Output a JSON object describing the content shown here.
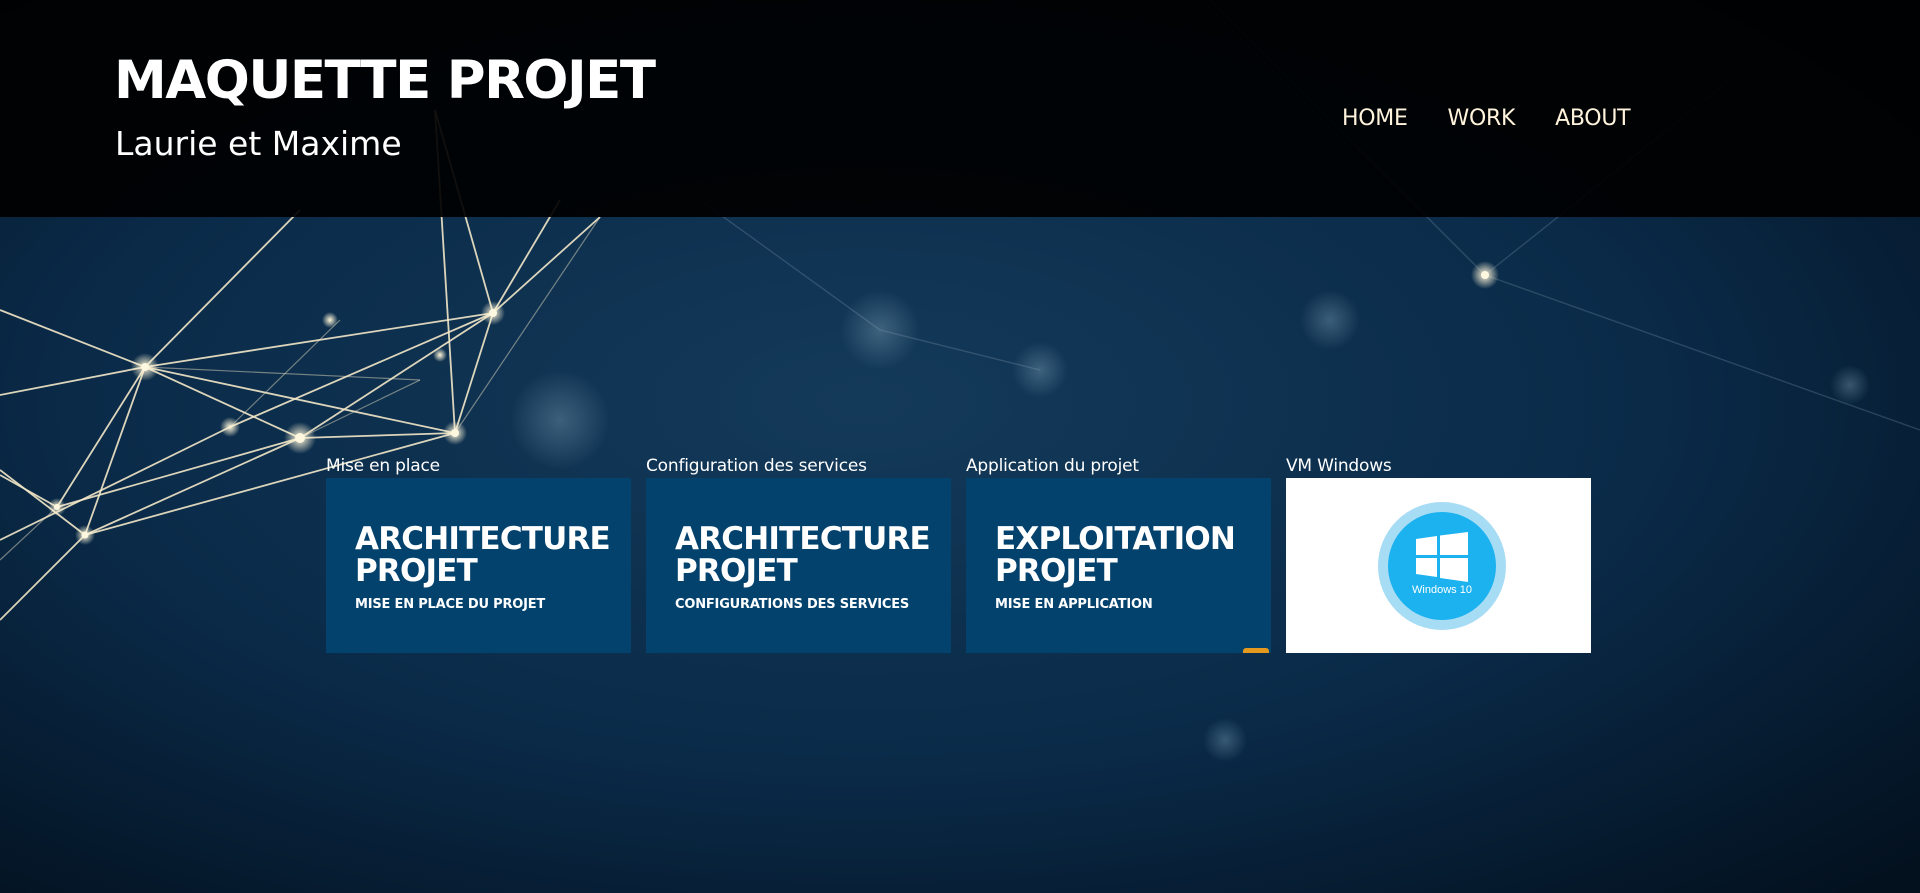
{
  "header": {
    "title": "MAQUETTE PROJET",
    "subtitle": "Laurie et Maxime"
  },
  "nav": {
    "items": [
      {
        "label": "HOME"
      },
      {
        "label": "WORK"
      },
      {
        "label": "ABOUT"
      }
    ]
  },
  "tiles": [
    {
      "caption": "Mise en place",
      "title_line1": "ARCHITECTURE",
      "title_line2": "PROJET",
      "subtitle": "MISE EN PLACE DU PROJET"
    },
    {
      "caption": "Configuration des services",
      "title_line1": "ARCHITECTURE",
      "title_line2": "PROJET",
      "subtitle": "CONFIGURATIONS DES SERVICES"
    },
    {
      "caption": "Application du projet",
      "title_line1": "EXPLOITATION",
      "title_line2": "PROJET",
      "subtitle": "MISE EN APPLICATION"
    },
    {
      "caption": "VM Windows",
      "image_label": "Windows 10",
      "icon": "windows-logo-icon"
    }
  ],
  "colors": {
    "header_bg": "#000000",
    "tile_bg": "#03426d",
    "windows_blue": "#1cb2ef",
    "accent": "#e39a1f"
  }
}
